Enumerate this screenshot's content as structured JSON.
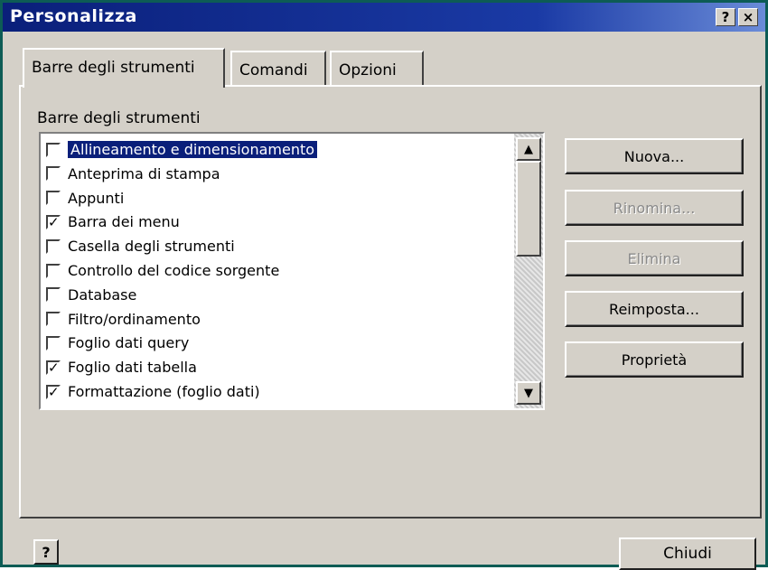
{
  "window": {
    "title": "Personalizza",
    "help_glyph": "?",
    "close_glyph": "×"
  },
  "tabs": [
    {
      "label": "Barre degli strumenti"
    },
    {
      "label": "Comandi"
    },
    {
      "label": "Opzioni"
    }
  ],
  "list_label": "Barre degli strumenti",
  "toolbars": [
    {
      "label": "Allineamento e dimensionamento",
      "checked": false,
      "selected": true
    },
    {
      "label": "Anteprima di stampa",
      "checked": false
    },
    {
      "label": "Appunti",
      "checked": false
    },
    {
      "label": "Barra dei menu",
      "checked": true
    },
    {
      "label": "Casella degli strumenti",
      "checked": false
    },
    {
      "label": "Controllo del codice sorgente",
      "checked": false
    },
    {
      "label": "Database",
      "checked": false
    },
    {
      "label": "Filtro/ordinamento",
      "checked": false
    },
    {
      "label": "Foglio dati query",
      "checked": false
    },
    {
      "label": "Foglio dati tabella",
      "checked": true
    },
    {
      "label": "Formattazione (foglio dati)",
      "checked": true
    }
  ],
  "buttons": {
    "new": "Nuova...",
    "rename": "Rinomina...",
    "delete": "Elimina",
    "reset": "Reimposta...",
    "properties": "Proprietà",
    "close": "Chiudi"
  },
  "scrollbar": {
    "up_glyph": "▲",
    "down_glyph": "▼"
  },
  "footer": {
    "help_glyph": "?"
  }
}
